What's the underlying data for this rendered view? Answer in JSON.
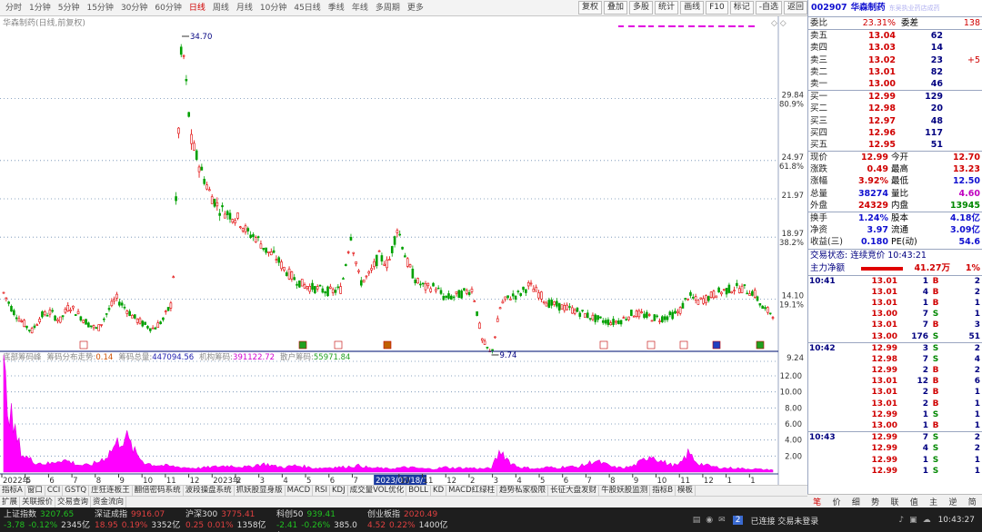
{
  "period_tabs": [
    "分时",
    "1分钟",
    "5分钟",
    "15分钟",
    "30分钟",
    "60分钟",
    "日线",
    "周线",
    "月线",
    "10分钟",
    "45日线",
    "季线",
    "年线",
    "多周期",
    "更多"
  ],
  "active_period": "日线",
  "tool_buttons": [
    "复权",
    "叠加",
    "多股",
    "统计",
    "画线",
    "F10",
    "标记",
    "-自选",
    "返回"
  ],
  "chart": {
    "title": "华森制药(日线,前复权)",
    "price_labels": [
      "29.84",
      "24.97",
      "21.97",
      "18.97",
      "14.10",
      "9.24"
    ],
    "pct_labels": [
      "80.9%",
      "61.8%",
      "38.2%",
      "19.1%"
    ],
    "high_marker": "34.70",
    "low_marker": "9.74",
    "indicator_title": "底部筹码峰",
    "indicator_items": [
      {
        "label": "筹码分布走势:",
        "value": "0.14"
      },
      {
        "label": "筹码总量:",
        "value": "447094.56"
      },
      {
        "label": "机构筹码:",
        "value": "391122.72"
      },
      {
        "label": "散户筹码:",
        "value": "55971.84"
      }
    ],
    "vol_axis": [
      "12.00",
      "10.00",
      "8.00",
      "6.00",
      "4.00",
      "2.00"
    ],
    "x_labels": [
      "2022年",
      "5",
      "6",
      "7",
      "8",
      "9",
      "10",
      "11",
      "12",
      "2023年",
      "2",
      "3",
      "4",
      "5",
      "6",
      "7",
      "2023/07/18/二",
      "10",
      "11",
      "12",
      "2",
      "3",
      "4",
      "5",
      "6",
      "7",
      "8",
      "9",
      "10",
      "11",
      "12",
      "1",
      "1"
    ],
    "cursor_date": "2023/07/18/二"
  },
  "chart_data": {
    "type": "line",
    "title": "华森制药(日线,前复权)",
    "ylabel": "",
    "ylim": [
      9.24,
      34.7
    ],
    "markers": {
      "high": 34.7,
      "low": 9.74
    },
    "series": [
      {
        "values": [
          14.6,
          13.2,
          12.3,
          11.6,
          12.8,
          13.1,
          12.4,
          13.6,
          12.9,
          12.2,
          11.7,
          13.0,
          14.2,
          13.4,
          12.6,
          12.1,
          11.8,
          12.5,
          13.9,
          34.7,
          26.5,
          24.3,
          22.4,
          21.2,
          20.8,
          20.4,
          19.3,
          18.9,
          17.9,
          17.4,
          16.4,
          15.7,
          15.2,
          15.0,
          14.8,
          14.7,
          14.9,
          19.2,
          15.4,
          16.0,
          17.5,
          16.8,
          19.8,
          17.0,
          15.5,
          15.0,
          15.1,
          14.2,
          14.3,
          14.6,
          14.9,
          10.9,
          9.74,
          13.7,
          14.3,
          14.5,
          15.2,
          14.6,
          13.8,
          13.6,
          13.4,
          13.2,
          12.9,
          12.6,
          12.4,
          12.3,
          12.5,
          13.0,
          12.9,
          12.7,
          12.6,
          12.8,
          13.1,
          14.4,
          13.9,
          14.2,
          14.6,
          14.8,
          15.0,
          14.9,
          14.6,
          13.3,
          12.99
        ]
      }
    ],
    "volume_ylim": [
      0,
      12
    ],
    "volume_values": [
      12.0,
      5.5,
      2.2,
      1.4,
      1.1,
      1.0,
      1.6,
      1.3,
      0.9,
      0.8,
      1.2,
      2.0,
      3.5,
      4.5,
      2.4,
      1.2,
      0.9,
      0.8,
      0.7,
      0.6,
      0.5,
      0.5,
      0.6,
      0.7,
      0.8,
      0.7,
      0.6,
      0.9,
      1.0,
      0.7,
      0.6,
      0.8,
      0.7,
      0.5,
      0.5,
      0.6,
      0.6,
      0.7,
      0.8,
      0.5,
      0.5,
      0.4,
      0.5,
      0.6,
      0.5,
      0.4,
      0.4,
      0.6,
      0.5,
      0.5,
      0.5,
      0.4,
      0.5,
      2.7,
      1.2,
      0.6,
      0.5,
      0.4,
      0.6,
      0.5,
      0.7,
      0.6,
      0.9,
      1.4,
      1.0,
      0.6,
      0.5,
      0.7,
      1.3,
      2.2,
      1.4,
      0.9,
      0.8,
      2.4,
      1.1,
      0.8,
      0.6,
      0.5,
      0.5,
      0.4,
      0.4,
      0.3,
      0.3
    ]
  },
  "quote": {
    "code": "002907",
    "name": "华森制药",
    "ticker_note": "东吴执业药店成药",
    "weibi_label": "委比",
    "weibi_value": "23.31%",
    "weicha_label": "委差",
    "weicha_value": "138",
    "asks": [
      {
        "label": "卖五",
        "price": "13.04",
        "vol": "62",
        "chg": ""
      },
      {
        "label": "卖四",
        "price": "13.03",
        "vol": "14",
        "chg": ""
      },
      {
        "label": "卖三",
        "price": "13.02",
        "vol": "23",
        "chg": "+5"
      },
      {
        "label": "卖二",
        "price": "13.01",
        "vol": "82",
        "chg": ""
      },
      {
        "label": "卖一",
        "price": "13.00",
        "vol": "46",
        "chg": ""
      }
    ],
    "bids": [
      {
        "label": "买一",
        "price": "12.99",
        "vol": "129",
        "chg": ""
      },
      {
        "label": "买二",
        "price": "12.98",
        "vol": "20",
        "chg": ""
      },
      {
        "label": "买三",
        "price": "12.97",
        "vol": "48",
        "chg": ""
      },
      {
        "label": "买四",
        "price": "12.96",
        "vol": "117",
        "chg": ""
      },
      {
        "label": "买五",
        "price": "12.95",
        "vol": "51",
        "chg": ""
      }
    ],
    "stats": [
      {
        "l1": "现价",
        "v1": "12.99",
        "c1": "red",
        "l2": "今开",
        "v2": "12.70",
        "c2": "red"
      },
      {
        "l1": "涨跌",
        "v1": "0.49",
        "c1": "red",
        "l2": "最高",
        "v2": "13.23",
        "c2": "red"
      },
      {
        "l1": "涨幅",
        "v1": "3.92%",
        "c1": "red",
        "l2": "最低",
        "v2": "12.50",
        "c2": "blue"
      },
      {
        "l1": "总量",
        "v1": "38274",
        "c1": "blue",
        "l2": "量比",
        "v2": "4.60",
        "c2": "mag"
      },
      {
        "l1": "外盘",
        "v1": "24329",
        "c1": "red",
        "l2": "内盘",
        "v2": "13945",
        "c2": "green"
      }
    ],
    "stats2": [
      {
        "l1": "换手",
        "v1": "1.24%",
        "c1": "blue",
        "l2": "股本",
        "v2": "4.18亿",
        "c2": "blue"
      },
      {
        "l1": "净资",
        "v1": "3.97",
        "c1": "blue",
        "l2": "流通",
        "v2": "3.09亿",
        "c2": "blue"
      },
      {
        "l1": "收益(三)",
        "v1": "0.180",
        "c1": "blue",
        "l2": "PE(动)",
        "v2": "54.6",
        "c2": "blue"
      }
    ],
    "trade_status": "交易状态: 连续竞价 10:43:21",
    "main_flow_label": "主力净额",
    "main_flow_value": "41.27万",
    "main_flow_pct": "1%",
    "ticks": [
      {
        "t": "10:41",
        "p": "13.01",
        "v": "1",
        "f": "B",
        "n": "2"
      },
      {
        "t": "",
        "p": "13.01",
        "v": "4",
        "f": "B",
        "n": "2"
      },
      {
        "t": "",
        "p": "13.01",
        "v": "1",
        "f": "B",
        "n": "1"
      },
      {
        "t": "",
        "p": "13.00",
        "v": "7",
        "f": "S",
        "n": "1"
      },
      {
        "t": "",
        "p": "13.01",
        "v": "7",
        "f": "B",
        "n": "3"
      },
      {
        "t": "",
        "p": "13.00",
        "v": "176",
        "f": "S",
        "n": "51"
      },
      {
        "t": "10:42",
        "p": "12.99",
        "v": "3",
        "f": "S",
        "n": "2"
      },
      {
        "t": "",
        "p": "12.98",
        "v": "7",
        "f": "S",
        "n": "4"
      },
      {
        "t": "",
        "p": "12.99",
        "v": "2",
        "f": "B",
        "n": "2"
      },
      {
        "t": "",
        "p": "13.01",
        "v": "12",
        "f": "B",
        "n": "6"
      },
      {
        "t": "",
        "p": "13.01",
        "v": "2",
        "f": "B",
        "n": "1"
      },
      {
        "t": "",
        "p": "13.01",
        "v": "2",
        "f": "B",
        "n": "1"
      },
      {
        "t": "",
        "p": "12.99",
        "v": "1",
        "f": "S",
        "n": "1"
      },
      {
        "t": "",
        "p": "13.00",
        "v": "1",
        "f": "B",
        "n": "1"
      },
      {
        "t": "10:43",
        "p": "12.99",
        "v": "7",
        "f": "S",
        "n": "2"
      },
      {
        "t": "",
        "p": "12.99",
        "v": "4",
        "f": "S",
        "n": "2"
      },
      {
        "t": "",
        "p": "12.99",
        "v": "1",
        "f": "S",
        "n": "1"
      },
      {
        "t": "",
        "p": "12.99",
        "v": "1",
        "f": "S",
        "n": "1"
      }
    ]
  },
  "indicator_tabs": [
    "指标A",
    "窗口",
    "CCI",
    "GSTQ",
    "庄狂连板王",
    "翻倍密码系统",
    "波段操盘系统",
    "抓妖股显身版",
    "MACD",
    "RSI",
    "KDJ",
    "成交量VOL优化",
    "BOLL",
    "KD",
    "MACD红绿柱",
    "趋势私家极限",
    "长征大盘发财",
    "牛股妖股监测",
    "指标B",
    "模板"
  ],
  "sub_tabs": [
    "扩展",
    "关联报价",
    "交易查询",
    "资金流向"
  ],
  "quote_tabs": [
    "笔",
    "价",
    "细",
    "势",
    "联",
    "值",
    "主",
    "逆",
    "简"
  ],
  "status": {
    "indices": [
      {
        "name": "上证指数",
        "val": "3207.65",
        "chg": "-3.78",
        "pct": "-0.12%",
        "amt": "2345亿",
        "up": false
      },
      {
        "name": "深证成指",
        "val": "9916.07",
        "chg": "18.95",
        "pct": "0.19%",
        "amt": "3352亿",
        "up": true
      },
      {
        "name": "沪深300",
        "val": "3775.41",
        "chg": "0.25",
        "pct": "0.01%",
        "amt": "1358亿",
        "up": true
      },
      {
        "name": "科创50",
        "val": "939.41",
        "chg": "-2.41",
        "pct": "-0.26%",
        "amt": "385.0亿",
        "up": false
      },
      {
        "name": "创业板指",
        "val": "2020.49",
        "chg": "4.52",
        "pct": "0.22%",
        "amt": "1400亿",
        "up": true
      }
    ],
    "connection": "已连接 交易未登录",
    "time": "10:43:27"
  }
}
